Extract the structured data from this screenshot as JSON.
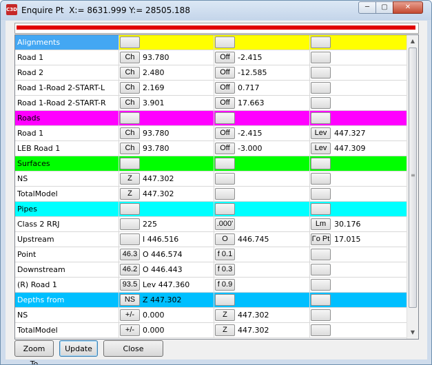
{
  "window": {
    "title": "Enquire Pt",
    "coords": "X:= 8631.999  Y:= 28505.188",
    "app_icon_text": "C3D",
    "controls": {
      "minimize": "─",
      "maximize": "▢",
      "close": "✕"
    }
  },
  "progress": {
    "color": "#e00000",
    "fraction": 1.0
  },
  "colors": {
    "alignments": "#43a7f3",
    "header_yellow": "#ffff00",
    "roads": "#ff00ff",
    "surfaces": "#00ff00",
    "pipes": "#00ffff",
    "depths": "#00bfff"
  },
  "rows": [
    {
      "name": "Alignments",
      "header": true,
      "c1": "#43a7f3",
      "c2": "#ffff00",
      "b1": "",
      "v1": "",
      "b2": "",
      "v2": "",
      "b3": "",
      "v3": ""
    },
    {
      "name": "Road 1",
      "b1": "Ch",
      "v1": "93.780",
      "b2": "Off",
      "v2": "-2.415",
      "b3": "",
      "v3": ""
    },
    {
      "name": "Road 2",
      "b1": "Ch",
      "v1": "2.480",
      "b2": "Off",
      "v2": "-12.585",
      "b3": "",
      "v3": ""
    },
    {
      "name": "Road 1-Road 2-START-L",
      "b1": "Ch",
      "v1": "2.169",
      "b2": "Off",
      "v2": "0.717",
      "b3": "",
      "v3": ""
    },
    {
      "name": "Road 1-Road 2-START-R",
      "b1": "Ch",
      "v1": "3.901",
      "b2": "Off",
      "v2": "17.663",
      "b3": "",
      "v3": ""
    },
    {
      "name": "Roads",
      "header": true,
      "c1": "#ff00ff",
      "c2": "#ff00ff",
      "b1": "",
      "v1": "",
      "b2": "",
      "v2": "",
      "b3": "",
      "v3": ""
    },
    {
      "name": "Road 1",
      "b1": "Ch",
      "v1": "93.780",
      "b2": "Off",
      "v2": "-2.415",
      "b3": "Lev",
      "v3": "447.327"
    },
    {
      "name": "LEB  Road 1",
      "b1": "Ch",
      "v1": "93.780",
      "b2": "Off",
      "v2": "-3.000",
      "b3": "Lev",
      "v3": "447.309"
    },
    {
      "name": "Surfaces",
      "header": true,
      "c1": "#00ff00",
      "c2": "#00ff00",
      "b1": "",
      "v1": "",
      "b2": "",
      "v2": "",
      "b3": "",
      "v3": ""
    },
    {
      "name": "NS",
      "b1": "Z",
      "v1": "447.302",
      "b2": "",
      "v2": "",
      "b3": "",
      "v3": ""
    },
    {
      "name": "TotalModel",
      "b1": "Z",
      "v1": "447.302",
      "b2": "",
      "v2": "",
      "b3": "",
      "v3": ""
    },
    {
      "name": "Pipes",
      "header": true,
      "c1": "#00ffff",
      "c2": "#00ffff",
      "b1": "",
      "v1": "",
      "b2": "",
      "v2": "",
      "b3": "",
      "v3": ""
    },
    {
      "name": "Class 2 RRJ",
      "b1": "",
      "v1": "225",
      "b2": ".000'",
      "v2": "",
      "b3": "Lm",
      "v3": "30.176"
    },
    {
      "name": "Upstream",
      "b1": "",
      "v1": "I 446.516",
      "b2": "O",
      "v2": "446.745",
      "b3": "Γo Pt",
      "v3": "17.015"
    },
    {
      "name": "Point",
      "b1": "46.3",
      "v1": "O 446.574",
      "b2": "f 0.1",
      "v2": "",
      "b3": "",
      "v3": ""
    },
    {
      "name": "Downstream",
      "b1": "46.2",
      "v1": "O 446.443",
      "b2": "f 0.3",
      "v2": "",
      "b3": "",
      "v3": ""
    },
    {
      "name": "(R) Road 1",
      "b1": "93.5",
      "v1": "Lev 447.360",
      "b2": "f 0.9",
      "v2": "",
      "b3": "",
      "v3": ""
    },
    {
      "name": "Depths from",
      "header": true,
      "c1": "#00bfff",
      "c2": "#00bfff",
      "b1": "NS",
      "v1": "Z 447.302",
      "b2": "",
      "v2": "",
      "b3": "",
      "v3": ""
    },
    {
      "name": "NS",
      "b1": "+/-",
      "v1": "0.000",
      "b2": "Z",
      "v2": "447.302",
      "b3": "",
      "v3": ""
    },
    {
      "name": "TotalModel",
      "b1": "+/-",
      "v1": "0.000",
      "b2": "Z",
      "v2": "447.302",
      "b3": "",
      "v3": ""
    }
  ],
  "buttons": {
    "zoom_to": "Zoom To",
    "update": "Update",
    "close": "Close"
  },
  "scrollbar": {
    "up": "▲",
    "down": "▼",
    "grip": "≡"
  }
}
